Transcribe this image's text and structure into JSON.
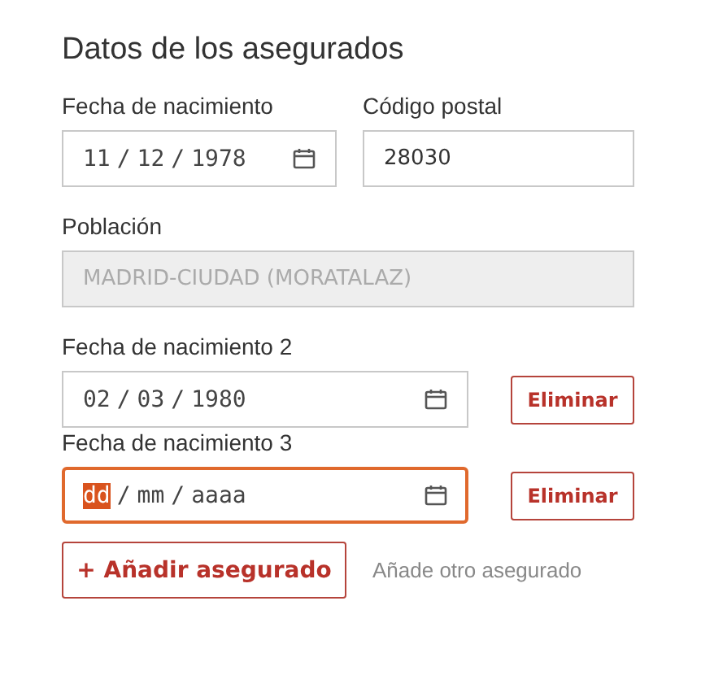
{
  "title": "Datos de los asegurados",
  "rows": [
    {
      "fields": [
        {
          "kind": "date",
          "label": "Fecha de nacimiento",
          "segments": [
            {
              "text": "11",
              "selected": false
            },
            {
              "text": "12",
              "selected": false
            },
            {
              "text": "1978",
              "selected": false
            }
          ],
          "separator": "/",
          "focused": false
        },
        {
          "kind": "text",
          "label": "Código postal",
          "value": "28030",
          "disabled": false
        }
      ]
    },
    {
      "fields": [
        {
          "kind": "text",
          "label": "Población",
          "value": "MADRID-CIUDAD (MORATALAZ)",
          "disabled": true
        }
      ]
    },
    {
      "fields": [
        {
          "kind": "date",
          "label": "Fecha de nacimiento 2",
          "segments": [
            {
              "text": "02",
              "selected": false
            },
            {
              "text": "03",
              "selected": false
            },
            {
              "text": "1980",
              "selected": false
            }
          ],
          "separator": "/",
          "focused": false
        }
      ],
      "remove_button": "Eliminar"
    },
    {
      "fields": [
        {
          "kind": "date",
          "label": "Fecha de nacimiento 3",
          "segments": [
            {
              "text": "dd",
              "selected": true
            },
            {
              "text": "mm",
              "selected": false
            },
            {
              "text": "aaaa",
              "selected": false
            }
          ],
          "separator": "/",
          "focused": true
        }
      ],
      "remove_button": "Eliminar"
    }
  ],
  "add_button": "+ Añadir asegurado",
  "add_hint": "Añade otro asegurado"
}
